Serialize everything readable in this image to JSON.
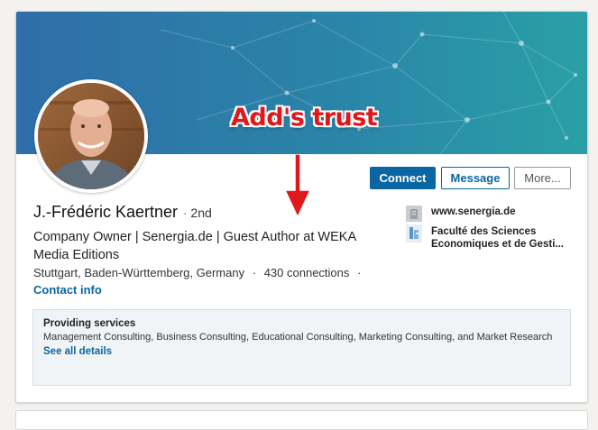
{
  "annotation": {
    "text": "Add's trust"
  },
  "profile": {
    "name": "J.-Frédéric Kaertner",
    "degree_separator": "·",
    "degree": "2nd",
    "headline": "Company Owner | Senergia.de | Guest Author at WEKA Media Editions",
    "location": "Stuttgart, Baden-Württemberg, Germany",
    "separator": "·",
    "connections": "430 connections",
    "trailing_separator": "·",
    "contact_info": "Contact info"
  },
  "actions": {
    "connect": "Connect",
    "message": "Message",
    "more": "More..."
  },
  "sidebar": {
    "website": "www.senergia.de",
    "education": "Faculté des Sciences Economiques et de Gesti..."
  },
  "services": {
    "title": "Providing services",
    "description": "Management Consulting, Business Consulting, Educational Consulting, Marketing Consulting, and Market Research",
    "link": "See all details"
  },
  "colors": {
    "brand_blue": "#0a66a2",
    "annotation_red": "#e0171b",
    "banner_start": "#2f6ea9",
    "banner_end": "#2aa0a6"
  },
  "icons": {
    "website": "building-icon",
    "education": "school-logo-icon",
    "annotation": "arrow-down-icon"
  }
}
